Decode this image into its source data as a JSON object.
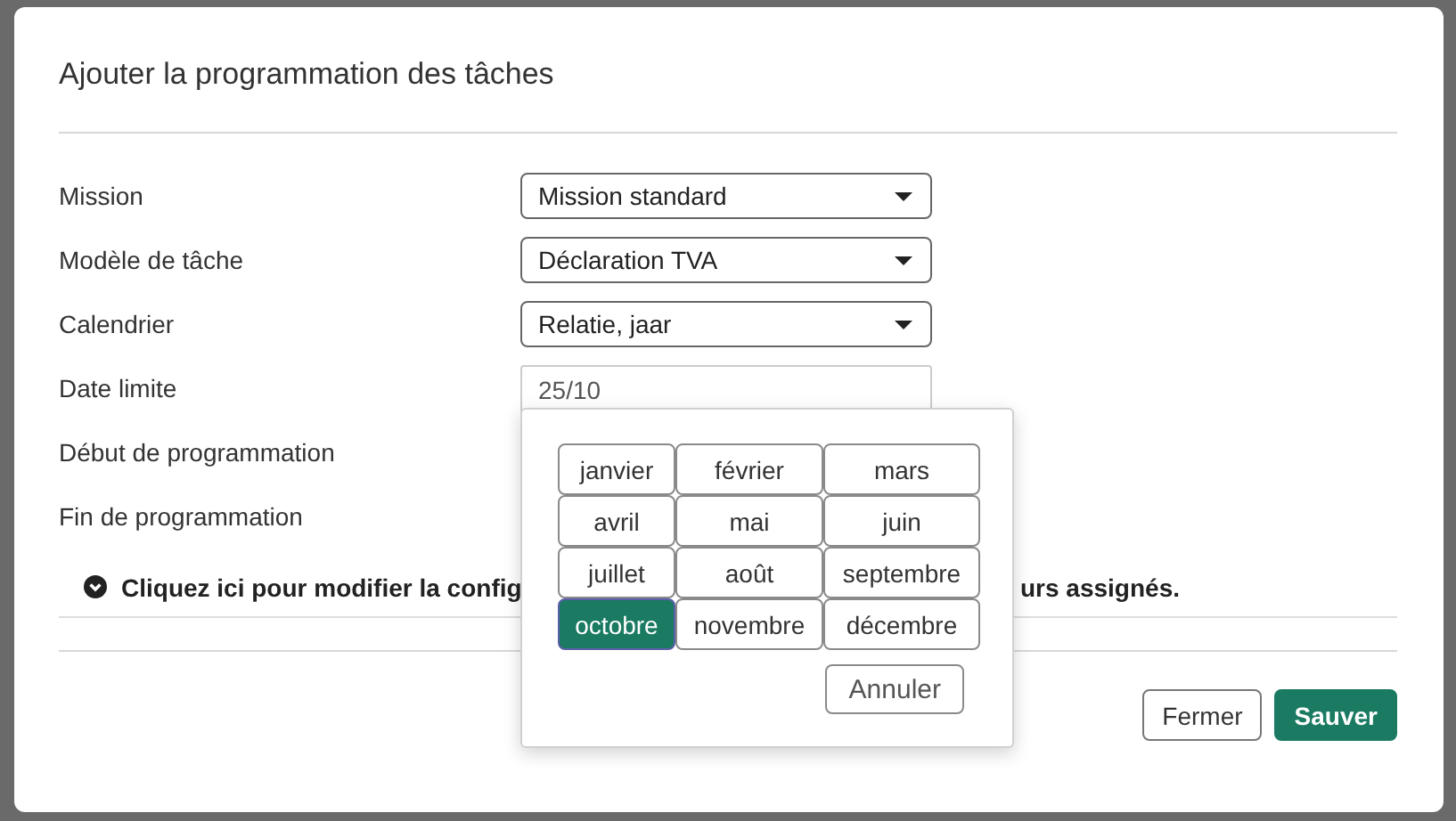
{
  "dialog": {
    "title": "Ajouter la programmation des tâches",
    "fields": [
      {
        "label": "Mission",
        "kind": "select",
        "value": "Mission standard"
      },
      {
        "label": "Modèle de tâche",
        "kind": "select",
        "value": "Déclaration TVA"
      },
      {
        "label": "Calendrier",
        "kind": "select",
        "value": "Relatie, jaar"
      },
      {
        "label": "Date limite",
        "kind": "text",
        "value": "25/10"
      },
      {
        "label": "Début de programmation",
        "kind": "covered"
      },
      {
        "label": "Fin de programmation",
        "kind": "covered"
      }
    ],
    "expander": {
      "text_before": "Cliquez ici pour modifier la config",
      "text_after": "urs assignés."
    },
    "buttons": [
      {
        "label": "Fermer",
        "kind": "secondary"
      },
      {
        "label": "Sauver",
        "kind": "primary"
      }
    ]
  },
  "month_picker": {
    "months": [
      {
        "label": "janvier",
        "selected": false
      },
      {
        "label": "février",
        "selected": false
      },
      {
        "label": "mars",
        "selected": false
      },
      {
        "label": "avril",
        "selected": false
      },
      {
        "label": "mai",
        "selected": false
      },
      {
        "label": "juin",
        "selected": false
      },
      {
        "label": "juillet",
        "selected": false
      },
      {
        "label": "août",
        "selected": false
      },
      {
        "label": "septembre",
        "selected": false
      },
      {
        "label": "octobre",
        "selected": true
      },
      {
        "label": "novembre",
        "selected": false
      },
      {
        "label": "décembre",
        "selected": false
      }
    ],
    "cancel": "Annuler"
  }
}
